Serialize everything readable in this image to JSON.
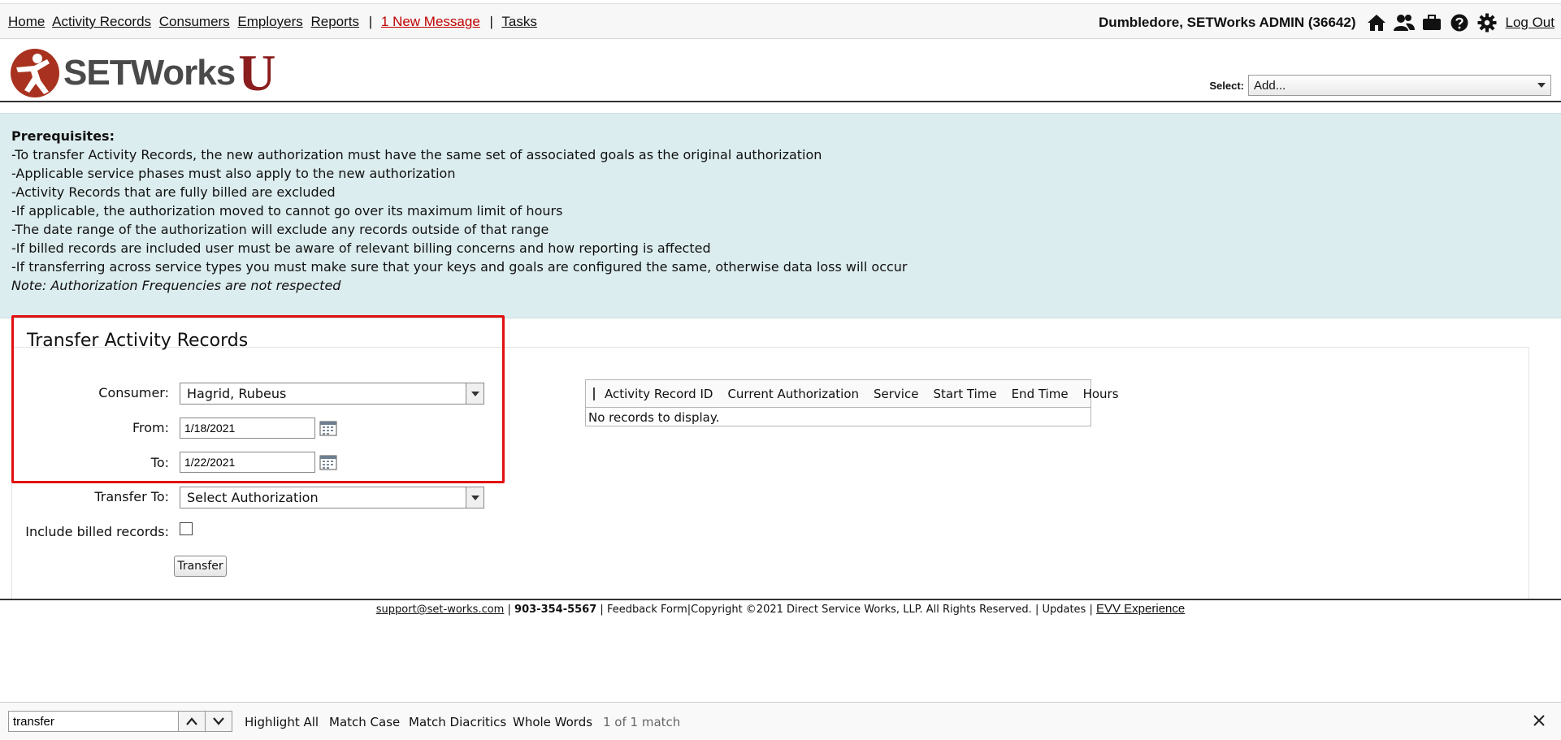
{
  "topnav": {
    "links": [
      "Home",
      "Activity Records",
      "Consumers",
      "Employers",
      "Reports"
    ],
    "message_link": "1 New Message",
    "tasks_link": "Tasks",
    "separator": "|",
    "user": "Dumbledore, SETWorks ADMIN  (36642)",
    "logout": "Log Out"
  },
  "header": {
    "logo_text": "SETWorks",
    "logo_u": "U",
    "select_label": "Select:",
    "select_value": "Add..."
  },
  "prereq": {
    "title": "Prerequisites:",
    "items": [
      "-To transfer Activity Records, the new authorization must have the same set of associated goals as the original authorization",
      "-Applicable service phases must also apply to the new authorization",
      "-Activity Records that are fully billed are excluded",
      "-If applicable, the authorization moved to cannot go over its maximum limit of hours",
      "-The date range of the authorization will exclude any records outside of that range",
      "-If billed records are included user must be aware of relevant billing concerns and how reporting is affected",
      "-If transferring across service types you must make sure that your keys and goals are configured the same, otherwise data loss will occur"
    ],
    "note": "Note: Authorization Frequencies are not respected"
  },
  "form": {
    "title": "Transfer Activity Records",
    "consumer_label": "Consumer:",
    "consumer_value": "Hagrid, Rubeus",
    "from_label": "From:",
    "from_value": "1/18/2021",
    "to_label": "To:",
    "to_value": "1/22/2021",
    "transfer_to_label": "Transfer To:",
    "transfer_to_value": "Select Authorization",
    "include_billed_label": "Include billed records:",
    "transfer_button": "Transfer"
  },
  "grid": {
    "columns": [
      "Activity Record ID",
      "Current Authorization",
      "Service",
      "Start Time",
      "End Time",
      "Hours"
    ],
    "empty_text": "No records to display."
  },
  "footer": {
    "email": "support@set-works.com",
    "sep": "|",
    "phone": "903-354-5567",
    "feedback": "Feedback Form",
    "copyright": "Copyright ©2021 Direct Service Works, LLP. All Rights Reserved.",
    "updates": "Updates",
    "evv": "EVV Experience"
  },
  "findbar": {
    "query": "transfer",
    "options": [
      "Highlight All",
      "Match Case",
      "Match Diacritics",
      "Whole Words"
    ],
    "result": "1 of 1 match"
  },
  "colors": {
    "accent_red": "#c00000",
    "highlight_box": "#e31010",
    "prereq_bg": "#dcedef",
    "logo_red": "#8a1e1e"
  }
}
